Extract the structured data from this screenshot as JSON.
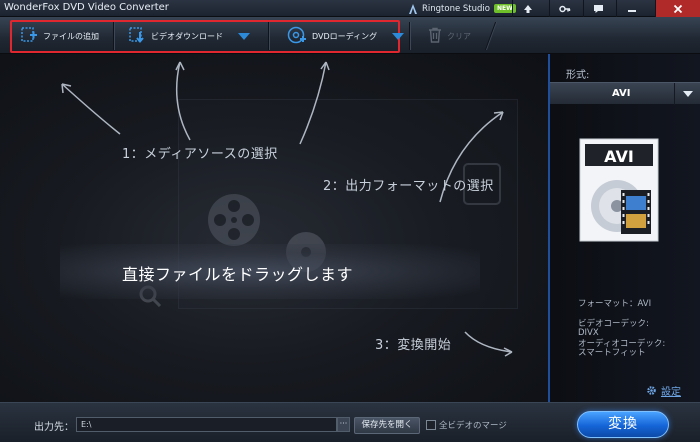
{
  "window": {
    "title": "WonderFox DVD Video Converter"
  },
  "titlebar": {
    "ringtone_label": "Ringtone Studio",
    "new_badge": "NEW",
    "controls": [
      "upload-icon",
      "key-icon",
      "chat-icon",
      "minimize-icon",
      "close-icon"
    ]
  },
  "toolbar": {
    "add_file": "ファイルの追加",
    "video_download": "ビデオダウンロード",
    "dvd_loading": "DVDローディング",
    "clear": "クリア"
  },
  "main": {
    "step1": "1：メディアソースの選択",
    "step2": "2：出力フォーマットの選択",
    "step3": "3：変換開始",
    "drop_text": "直接ファイルをドラッグします"
  },
  "format_panel": {
    "label": "形式:",
    "selected": "AVI",
    "icon_text": "AVI",
    "format_info": "フォーマット：AVI",
    "video_codec_label": "ビデオコーデック:",
    "video_codec_value": "DIVX",
    "audio_codec_label": "オーディオコーデック:",
    "audio_codec_value": "スマートフィット",
    "settings": "設定"
  },
  "bottom": {
    "output_label": "出力先：",
    "output_path": "E:\\",
    "browse": "···",
    "open_folder": "保存先を開く",
    "merge_label": "全ビデオのマージ",
    "convert": "変換"
  },
  "colors": {
    "accent_blue": "#2c8ad8",
    "highlight_red": "#e0262e",
    "convert_blue": "#1565d8",
    "new_badge_green": "#6fbf2a"
  }
}
